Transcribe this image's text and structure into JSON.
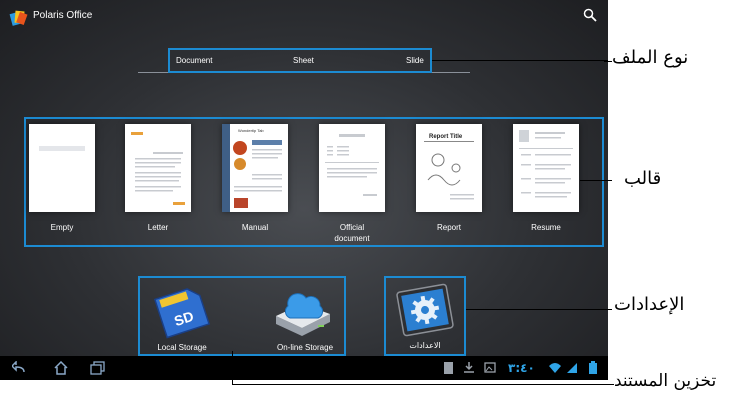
{
  "app": {
    "title": "Polaris Office",
    "icon": "polaris-office-logo-icon"
  },
  "header": {
    "search_icon": "search-icon"
  },
  "file_type_tabs": {
    "items": [
      {
        "label": "Document",
        "selected": true
      },
      {
        "label": "Sheet",
        "selected": false
      },
      {
        "label": "Slide",
        "selected": false
      }
    ]
  },
  "templates": [
    {
      "label": "Empty"
    },
    {
      "label": "Letter"
    },
    {
      "label": "Manual"
    },
    {
      "label": "Official\ndocument"
    },
    {
      "label": "Report"
    },
    {
      "label": "Resume"
    }
  ],
  "template_text": {
    "manual_heading": "Wondertip Tab",
    "report_heading": "Report Title"
  },
  "storage": {
    "local": "Local Storage",
    "online": "On-line Storage"
  },
  "settings": {
    "label": "الاعدادات"
  },
  "status_bar": {
    "time": "٣:٤٠",
    "nav_icons": [
      "back-icon",
      "home-icon",
      "recent-apps-icon"
    ],
    "status_icons": [
      "document-icon",
      "download-icon",
      "image-icon",
      "wifi-icon",
      "signal-icon",
      "battery-icon"
    ]
  },
  "callouts": {
    "file_type": "نوع الملف",
    "template": "قالب",
    "settings": "الإعدادات",
    "storage": "تخزين المستند"
  },
  "colors": {
    "highlight": "#1c8bd2",
    "background": "#2e3034"
  }
}
